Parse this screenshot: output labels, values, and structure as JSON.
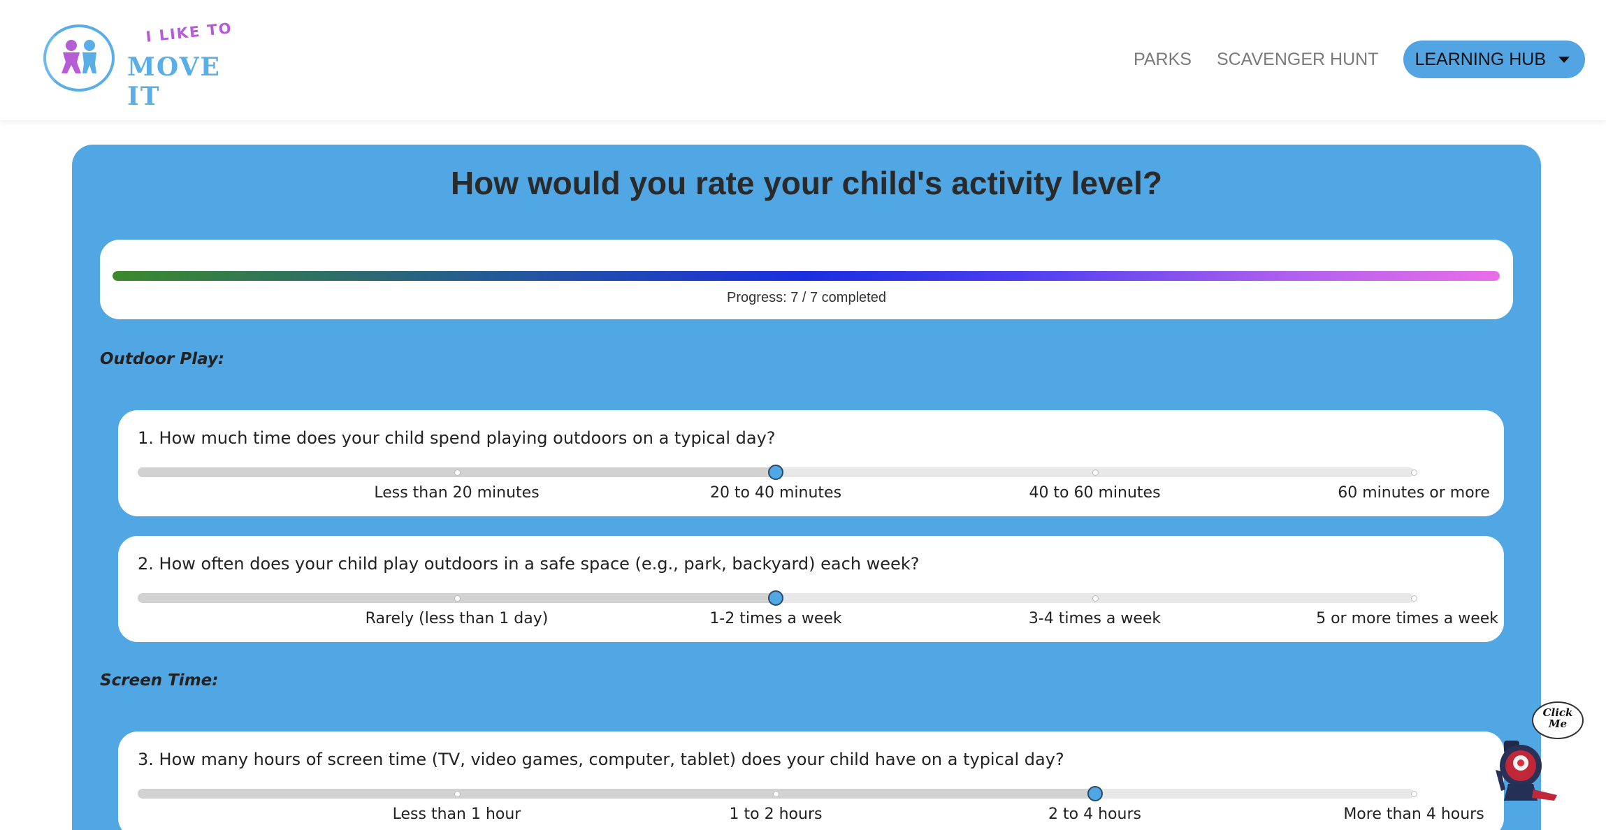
{
  "header": {
    "logo": {
      "top_text": "I LIKE TO",
      "main_text": "MOVE IT"
    },
    "nav": {
      "parks": "PARKS",
      "scavenger_hunt": "SCAVENGER HUNT",
      "learning_hub": "LEARNING HUB"
    }
  },
  "main": {
    "title": "How would you rate your child's activity level?",
    "progress": {
      "text": "Progress: 7 / 7 completed",
      "completed": 7,
      "total": 7,
      "fraction": 1.0
    },
    "sections": [
      {
        "label": "Outdoor Play:"
      },
      {
        "label": "Screen Time:"
      }
    ],
    "questions": [
      {
        "text": "1. How much time does your child spend playing outdoors on a typical day?",
        "options": [
          "Less than 20 minutes",
          "20 to 40 minutes",
          "40 to 60 minutes",
          "60 minutes or more"
        ],
        "selected_index": 1
      },
      {
        "text": "2. How often does your child play outdoors in a safe space (e.g., park, backyard) each week?",
        "options": [
          "Rarely (less than 1 day)",
          "1-2 times a week",
          "3-4 times a week",
          "5 or more times a week"
        ],
        "selected_index": 1
      },
      {
        "text": "3. How many hours of screen time (TV, video games, computer, tablet) does your child have on a typical day?",
        "options": [
          "Less than 1 hour",
          "1 to 2 hours",
          "2 to 4 hours",
          "More than 4 hours"
        ],
        "selected_index": 2
      }
    ]
  },
  "mascot": {
    "bubble_text": "Click Me"
  },
  "colors": {
    "accent": "#51a6e4",
    "logo_purple": "#b65cd6",
    "logo_blue": "#5aaee8"
  }
}
